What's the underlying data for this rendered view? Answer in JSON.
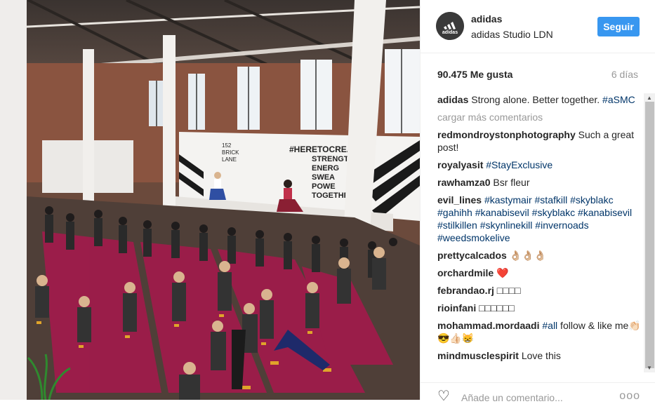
{
  "post": {
    "username": "adidas",
    "location": "adidas Studio LDN",
    "follow_label": "Seguir",
    "likes": "90.475 Me gusta",
    "age": "6 días",
    "load_more": "cargar más comentarios",
    "add_comment_placeholder": "Añade un comentario...",
    "options": "ooo",
    "photo_banner": "#HERETOCREAT",
    "photo_words": [
      "STRENGT",
      "ENERG",
      "SWEA",
      "POWE",
      "TOGETHE"
    ],
    "photo_logo_lines": [
      "152",
      "BRICK",
      "LANE"
    ],
    "avatar_text": "adidas"
  },
  "comments": [
    {
      "user": "adidas",
      "parts": [
        {
          "t": "Strong alone. Better together. "
        },
        {
          "t": "#aSMC",
          "tag": true
        }
      ]
    },
    {
      "user": "redmondroystonphotography",
      "parts": [
        {
          "t": "Such a great post!"
        }
      ]
    },
    {
      "user": "royalyasit",
      "parts": [
        {
          "t": "#StayExclusive",
          "tag": true
        }
      ]
    },
    {
      "user": "rawhamza0",
      "parts": [
        {
          "t": "Bsr fleur"
        }
      ]
    },
    {
      "user": "evil_lines",
      "parts": [
        {
          "t": "#kastymair",
          "tag": true
        },
        {
          "t": " "
        },
        {
          "t": "#stafkill",
          "tag": true
        },
        {
          "t": " "
        },
        {
          "t": "#skyblakc",
          "tag": true
        },
        {
          "t": " "
        },
        {
          "t": "#gahihh",
          "tag": true
        },
        {
          "t": " "
        },
        {
          "t": "#kanabisevil",
          "tag": true
        },
        {
          "t": " "
        },
        {
          "t": "#skyblakc",
          "tag": true
        },
        {
          "t": " "
        },
        {
          "t": "#kanabisevil",
          "tag": true
        },
        {
          "t": " "
        },
        {
          "t": "#stilkillen",
          "tag": true
        },
        {
          "t": " "
        },
        {
          "t": "#skynlinekill",
          "tag": true
        },
        {
          "t": " "
        },
        {
          "t": "#invernoads",
          "tag": true
        },
        {
          "t": " "
        },
        {
          "t": "#weedsmokelive",
          "tag": true
        }
      ]
    },
    {
      "user": "prettycalcados",
      "parts": [
        {
          "t": "👌🏼👌🏼👌🏼"
        }
      ]
    },
    {
      "user": "orchardmile",
      "parts": [
        {
          "t": "❤️"
        }
      ]
    },
    {
      "user": "febrandao.rj",
      "parts": [
        {
          "t": "□□□□"
        }
      ]
    },
    {
      "user": "rioinfani",
      "parts": [
        {
          "t": "□□□□□□"
        }
      ]
    },
    {
      "user": "mohammad.mordaadi",
      "parts": [
        {
          "t": "#all",
          "tag": true
        },
        {
          "t": " follow & like me👏🏻😎👍🏻😸"
        }
      ]
    },
    {
      "user": "mindmusclespirit",
      "parts": [
        {
          "t": "Love this"
        }
      ]
    }
  ]
}
